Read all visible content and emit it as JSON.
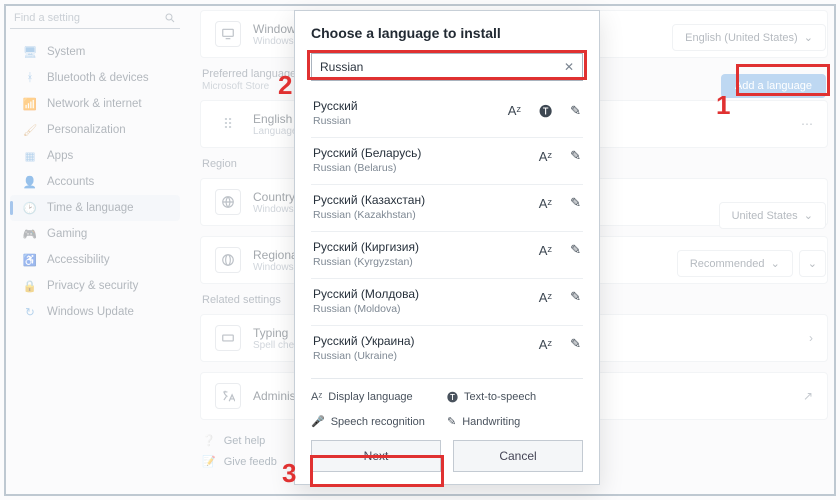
{
  "search": {
    "placeholder": "Find a setting"
  },
  "nav": [
    {
      "label": "System",
      "active": false
    },
    {
      "label": "Bluetooth & devices",
      "active": false
    },
    {
      "label": "Network & internet",
      "active": false
    },
    {
      "label": "Personalization",
      "active": false
    },
    {
      "label": "Apps",
      "active": false
    },
    {
      "label": "Accounts",
      "active": false
    },
    {
      "label": "Time & language",
      "active": true
    },
    {
      "label": "Gaming",
      "active": false
    },
    {
      "label": "Accessibility",
      "active": false
    },
    {
      "label": "Privacy & security",
      "active": false
    },
    {
      "label": "Windows Update",
      "active": false
    }
  ],
  "top_row": {
    "title": "Windows",
    "sub": "Windows"
  },
  "display_lang_pill": "English (United States)",
  "pref_section": "Preferred languages",
  "pref_sub": "Microsoft Store",
  "add_language_btn": "Add a language",
  "pref_item": {
    "title": "English (",
    "sub": "Language"
  },
  "region_section": "Region",
  "region_row1": {
    "title": "Country o",
    "sub": "Windows a",
    "value": "United States"
  },
  "region_row2": {
    "title": "Regional",
    "sub": "Windows a",
    "value": "Recommended"
  },
  "related_section": "Related settings",
  "typing_row": {
    "title": "Typing",
    "sub": "Spell check"
  },
  "admin_row": {
    "title": "Administr"
  },
  "help": {
    "get_help": "Get help",
    "feedback": "Give feedb"
  },
  "dialog": {
    "title": "Choose a language to install",
    "query": "Russian",
    "items": [
      {
        "native": "Русский",
        "eng": "Russian",
        "caps": [
          "display",
          "tts",
          "hand"
        ]
      },
      {
        "native": "Русский (Беларусь)",
        "eng": "Russian (Belarus)",
        "caps": [
          "display",
          "hand"
        ]
      },
      {
        "native": "Русский (Казахстан)",
        "eng": "Russian (Kazakhstan)",
        "caps": [
          "display",
          "hand"
        ]
      },
      {
        "native": "Русский (Киргизия)",
        "eng": "Russian (Kyrgyzstan)",
        "caps": [
          "display",
          "hand"
        ]
      },
      {
        "native": "Русский (Молдова)",
        "eng": "Russian (Moldova)",
        "caps": [
          "display",
          "hand"
        ]
      },
      {
        "native": "Русский (Украина)",
        "eng": "Russian (Ukraine)",
        "caps": [
          "display",
          "hand"
        ]
      }
    ],
    "legend": {
      "display": "Display language",
      "tts": "Text-to-speech",
      "speech": "Speech recognition",
      "hand": "Handwriting"
    },
    "next": "Next",
    "cancel": "Cancel"
  },
  "annotations": {
    "n1": "1",
    "n2": "2",
    "n3": "3"
  }
}
